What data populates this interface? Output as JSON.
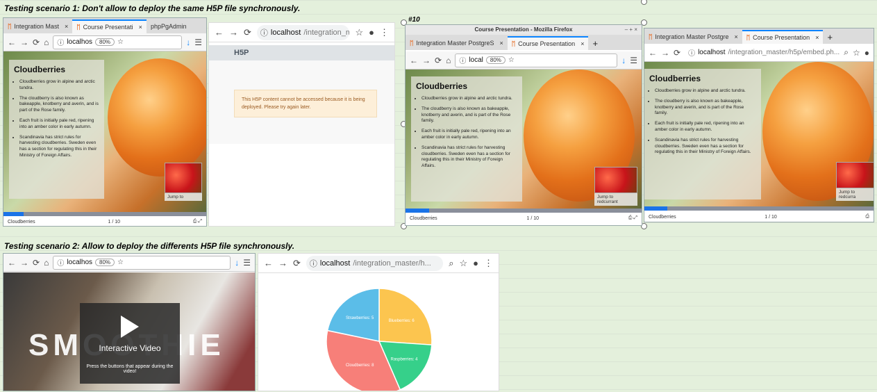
{
  "headings": {
    "scenario1": "Testing scenario 1: Don't allow to deploy the same H5P file synchronously.",
    "scenario2": "Testing scenario 2: Allow to deploy the differents H5P file synchronously.",
    "cell_label": "#10"
  },
  "win1": {
    "tabs": [
      "Integration Mast",
      "Course Presentati",
      "phpPgAdmin"
    ],
    "url_host": "localhos",
    "zoom": "80%"
  },
  "win2": {
    "url_host": "localhost",
    "url_path": "/integration_master/h...",
    "logo": "H5P",
    "warning": "This H5P content cannot be accessed because it is being deployed. Please try again later."
  },
  "win3": {
    "title": "Course Presentation - Mozilla Firefox",
    "tabs": [
      "Integration Master PostgreS",
      "Course Presentation"
    ],
    "url_host": "local",
    "zoom": "80%"
  },
  "win4": {
    "tabs": [
      "Integration Master Postgre",
      "Course Presentation"
    ],
    "url_host": "localhost",
    "url_path": "/integration_master/h5p/embed.ph..."
  },
  "slide": {
    "title": "Cloudberries",
    "bullets": [
      "Cloudberries grow in alpine and arctic tundra.",
      "The cloudberry is also known as bakeapple, knotberry and averin, and is part of the Rose family.",
      "Each fruit is initially pale red, ripening into an amber color in early autumn.",
      "Scandinavia has strict rules for harvesting cloudberries. Sweden even has a section for regulating this in their Ministry of Foreign Affairs."
    ],
    "jump_short": "Jump to",
    "jump_full": "Jump to redcurrant",
    "jump_cut": "Jump to redcurra",
    "footer_label": "Cloudberries",
    "page": "1 / 10",
    "progress": 0.1
  },
  "win5": {
    "url_host": "localhos",
    "zoom": "80%",
    "video_title": "Interactive Video",
    "video_hint": "Press the buttons that appear during the video!",
    "bg_word": "SMOOTHIE"
  },
  "win6": {
    "url_host": "localhost",
    "url_path": "/integration_master/h..."
  },
  "chart_data": {
    "type": "pie",
    "slices": [
      {
        "label": "Blueberries: 6",
        "name": "Blueberries",
        "value": 6,
        "color": "#fcc54f"
      },
      {
        "label": "Raspberries: 4",
        "name": "Raspberries",
        "value": 4,
        "color": "#36d08a"
      },
      {
        "label": "Cloudberries: 8",
        "name": "Cloudberries",
        "value": 8,
        "color": "#f77f79"
      },
      {
        "label": "Strawberries: 5",
        "name": "Strawberries",
        "value": 5,
        "color": "#5bbde8"
      }
    ]
  }
}
